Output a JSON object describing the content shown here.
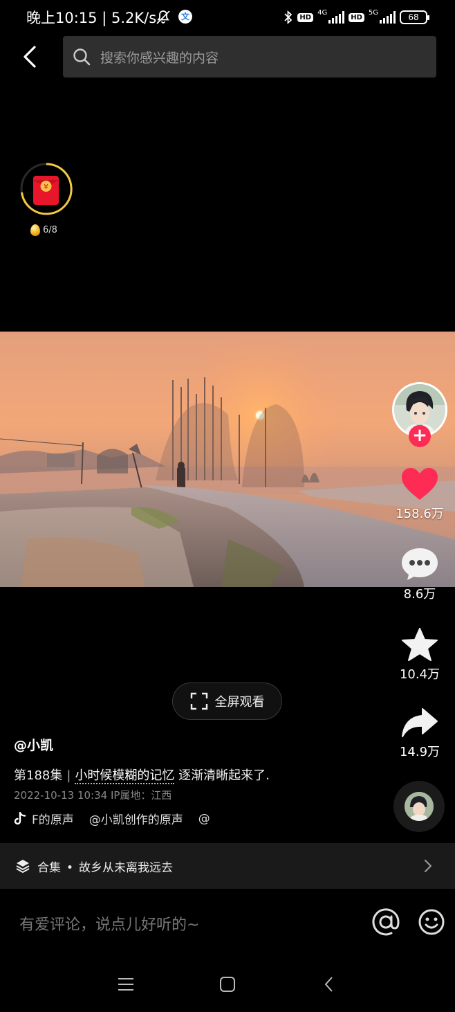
{
  "status_bar": {
    "time": "晚上10:15",
    "speed": "5.2K/s",
    "app_badge": "文",
    "hd1": "HD",
    "net1": "4G",
    "hd2": "HD",
    "net2": "5G",
    "battery": "68"
  },
  "search": {
    "placeholder": "搜索你感兴趣的内容"
  },
  "red_packet": {
    "progress": "6/8"
  },
  "actions": {
    "likes": "158.6万",
    "comments": "8.6万",
    "favorites": "10.4万",
    "shares": "14.9万"
  },
  "colors": {
    "like": "#fe2c55",
    "follow": "#fe2c55"
  },
  "fullscreen": {
    "label": "全屏观看"
  },
  "post": {
    "author": "@小凯",
    "episode": "第188集",
    "title_highlight": "小时候模糊的记忆",
    "title_rest": "逐渐清晰起来了.",
    "date": "2022-10-13 10:34",
    "ip": "IP属地：江西",
    "music1": "F的原声",
    "music2": "@小凯创作的原声",
    "music3": "@"
  },
  "collection": {
    "label": "合集",
    "name": "故乡从未离我远去"
  },
  "comment": {
    "placeholder": "有爱评论，说点儿好听的~"
  }
}
